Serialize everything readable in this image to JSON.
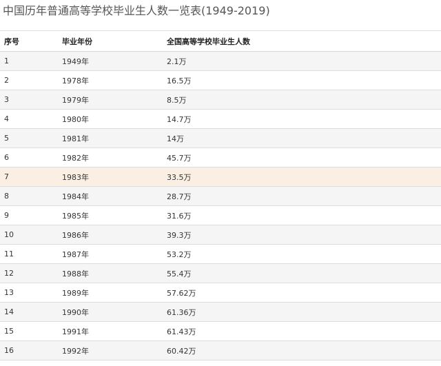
{
  "title": "中国历年普通高等学校毕业生人数一览表(1949-2019)",
  "table": {
    "headers": {
      "seq": "序号",
      "year": "毕业年份",
      "count": "全国高等学校毕业生人数"
    },
    "rows": [
      {
        "seq": "1",
        "year": "1949年",
        "count": "2.1万"
      },
      {
        "seq": "2",
        "year": "1978年",
        "count": "16.5万"
      },
      {
        "seq": "3",
        "year": "1979年",
        "count": "8.5万"
      },
      {
        "seq": "4",
        "year": "1980年",
        "count": "14.7万"
      },
      {
        "seq": "5",
        "year": "1981年",
        "count": "14万"
      },
      {
        "seq": "6",
        "year": "1982年",
        "count": "45.7万"
      },
      {
        "seq": "7",
        "year": "1983年",
        "count": "33.5万"
      },
      {
        "seq": "8",
        "year": "1984年",
        "count": "28.7万"
      },
      {
        "seq": "9",
        "year": "1985年",
        "count": "31.6万"
      },
      {
        "seq": "10",
        "year": "1986年",
        "count": "39.3万"
      },
      {
        "seq": "11",
        "year": "1987年",
        "count": "53.2万"
      },
      {
        "seq": "12",
        "year": "1988年",
        "count": "55.4万"
      },
      {
        "seq": "13",
        "year": "1989年",
        "count": "57.62万"
      },
      {
        "seq": "14",
        "year": "1990年",
        "count": "61.36万"
      },
      {
        "seq": "15",
        "year": "1991年",
        "count": "61.43万"
      },
      {
        "seq": "16",
        "year": "1992年",
        "count": "60.42万"
      }
    ]
  }
}
